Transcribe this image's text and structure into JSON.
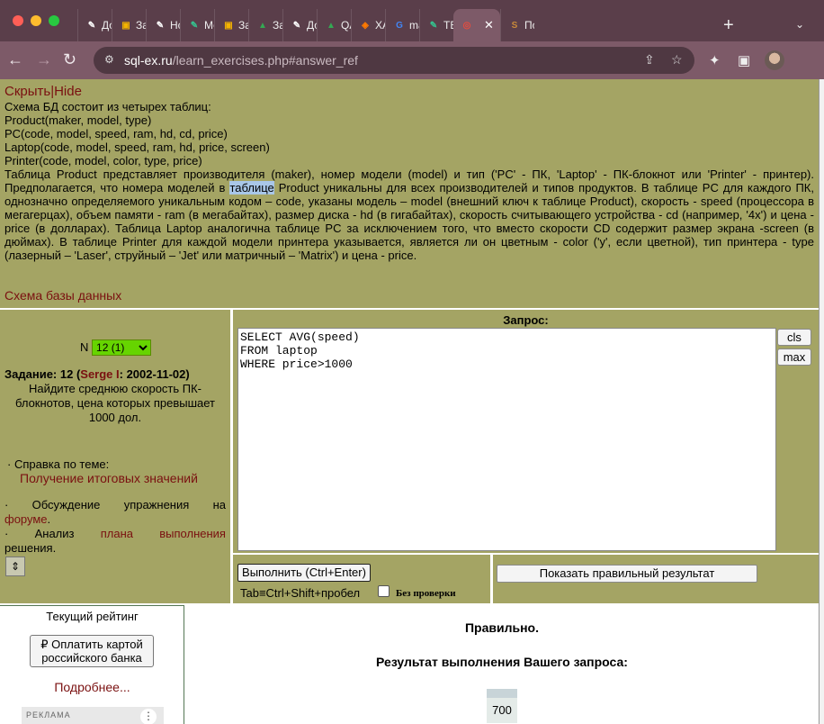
{
  "browser": {
    "tabs": [
      {
        "title": "До",
        "icon": "feather-icon",
        "color": "#ffffff"
      },
      {
        "title": "За",
        "icon": "slides-icon",
        "color": "#f4b400"
      },
      {
        "title": "Нс",
        "icon": "feather-icon",
        "color": "#ffffff"
      },
      {
        "title": "Мс",
        "icon": "feather-green-icon",
        "color": "#34c38f"
      },
      {
        "title": "За",
        "icon": "slides-icon",
        "color": "#f4b400"
      },
      {
        "title": "За",
        "icon": "drive-icon",
        "color": "#34a853"
      },
      {
        "title": "До",
        "icon": "feather-icon",
        "color": "#ffffff"
      },
      {
        "title": "QA",
        "icon": "drive-icon",
        "color": "#34a853"
      },
      {
        "title": "XA",
        "icon": "diamond-icon",
        "color": "#ff7a00"
      },
      {
        "title": "ma",
        "icon": "google-icon",
        "color": "#4285f4"
      },
      {
        "title": "TE",
        "icon": "feather-green-icon",
        "color": "#34c38f"
      },
      {
        "title": "",
        "icon": "target-icon",
        "color": "#e94b3c",
        "active": true,
        "close": "✕"
      },
      {
        "title": "По",
        "icon": "s-icon",
        "color": "#c98a3a"
      }
    ],
    "url_host": "sql-ex.ru",
    "url_path": "/learn_exercises.php#answer_ref"
  },
  "description": {
    "hide_link": "Скрыть|Hide",
    "lines": [
      "Схема БД состоит из четырех таблиц:",
      "Product(maker, model, type)",
      "PC(code, model, speed, ram, hd, cd, price)",
      "Laptop(code, model, speed, ram, hd, price, screen)",
      "Printer(code, model, color, type, price)"
    ],
    "para_before_hl": "Таблица Product представляет производителя (maker), номер модели (model) и тип ('PC' - ПК, 'Laptop' - ПК-блокнот или 'Printer' - принтер). Предполагается, что номера моделей в ",
    "para_hl": "таблице",
    "para_after_hl": " Product уникальны для всех производителей и типов продуктов. В таблице PC для каждого ПК, однозначно определяемого уникальным кодом – code, указаны модель – model (внешний ключ к таблице Product), скорость - speed (процессора в мегагерцах), объем памяти - ram (в мегабайтах), размер диска - hd (в гигабайтах), скорость считывающего устройства - cd (например, '4x') и цена - price (в долларах). Таблица Laptop аналогична таблице PC за исключением того, что вместо скорости CD содержит размер экрана -screen (в дюймах). В таблице Printer для каждой модели принтера указывается, является ли он цветным - color ('y', если цветной), тип принтера - type (лазерный – 'Laser', струйный – 'Jet' или матричный – 'Matrix') и цена - price.",
    "schema_link": "Схема базы данных"
  },
  "task": {
    "n_label": "N",
    "n_value": "12 (1)",
    "header_prefix": "Задание: 12 (",
    "author": "Serge I",
    "header_suffix": ": 2002-11-02)",
    "text": "Найдите среднюю скорость ПК-блокнотов, цена которых превышает 1000 дол.",
    "help_label": "· Справка по теме:",
    "help_link": "Получение итоговых значений",
    "forum_w1": "·",
    "forum_w2": "Обсуждение",
    "forum_w3": "упражнения",
    "forum_w4": "на",
    "forum_link": "форуме",
    "forum_dot": ".",
    "plan_w1": "·",
    "plan_w2": "Анализ",
    "plan_link1": "плана",
    "plan_link2": "выполнения",
    "plan_end": "решения."
  },
  "query": {
    "title": "Запрос:",
    "sql": "SELECT AVG(speed)\nFROM laptop\nWHERE price>1000",
    "cls": "cls",
    "max": "max",
    "run": "Выполнить (Ctrl+Enter)",
    "tab_hint": "Tab≡Ctrl+Shift+пробел",
    "no_verify": "Без проверки",
    "show_correct": "Показать правильный результат"
  },
  "rating": {
    "title": "Текущий рейтинг",
    "pay_button": "₽ Оплатить картой российского банка",
    "more": "Подробнее...",
    "ad_label": "РЕКЛАМА",
    "ad_menu": "⋮"
  },
  "result": {
    "status": "Правильно.",
    "title": "Результат выполнения Вашего запроса:",
    "values": [
      "700"
    ]
  }
}
